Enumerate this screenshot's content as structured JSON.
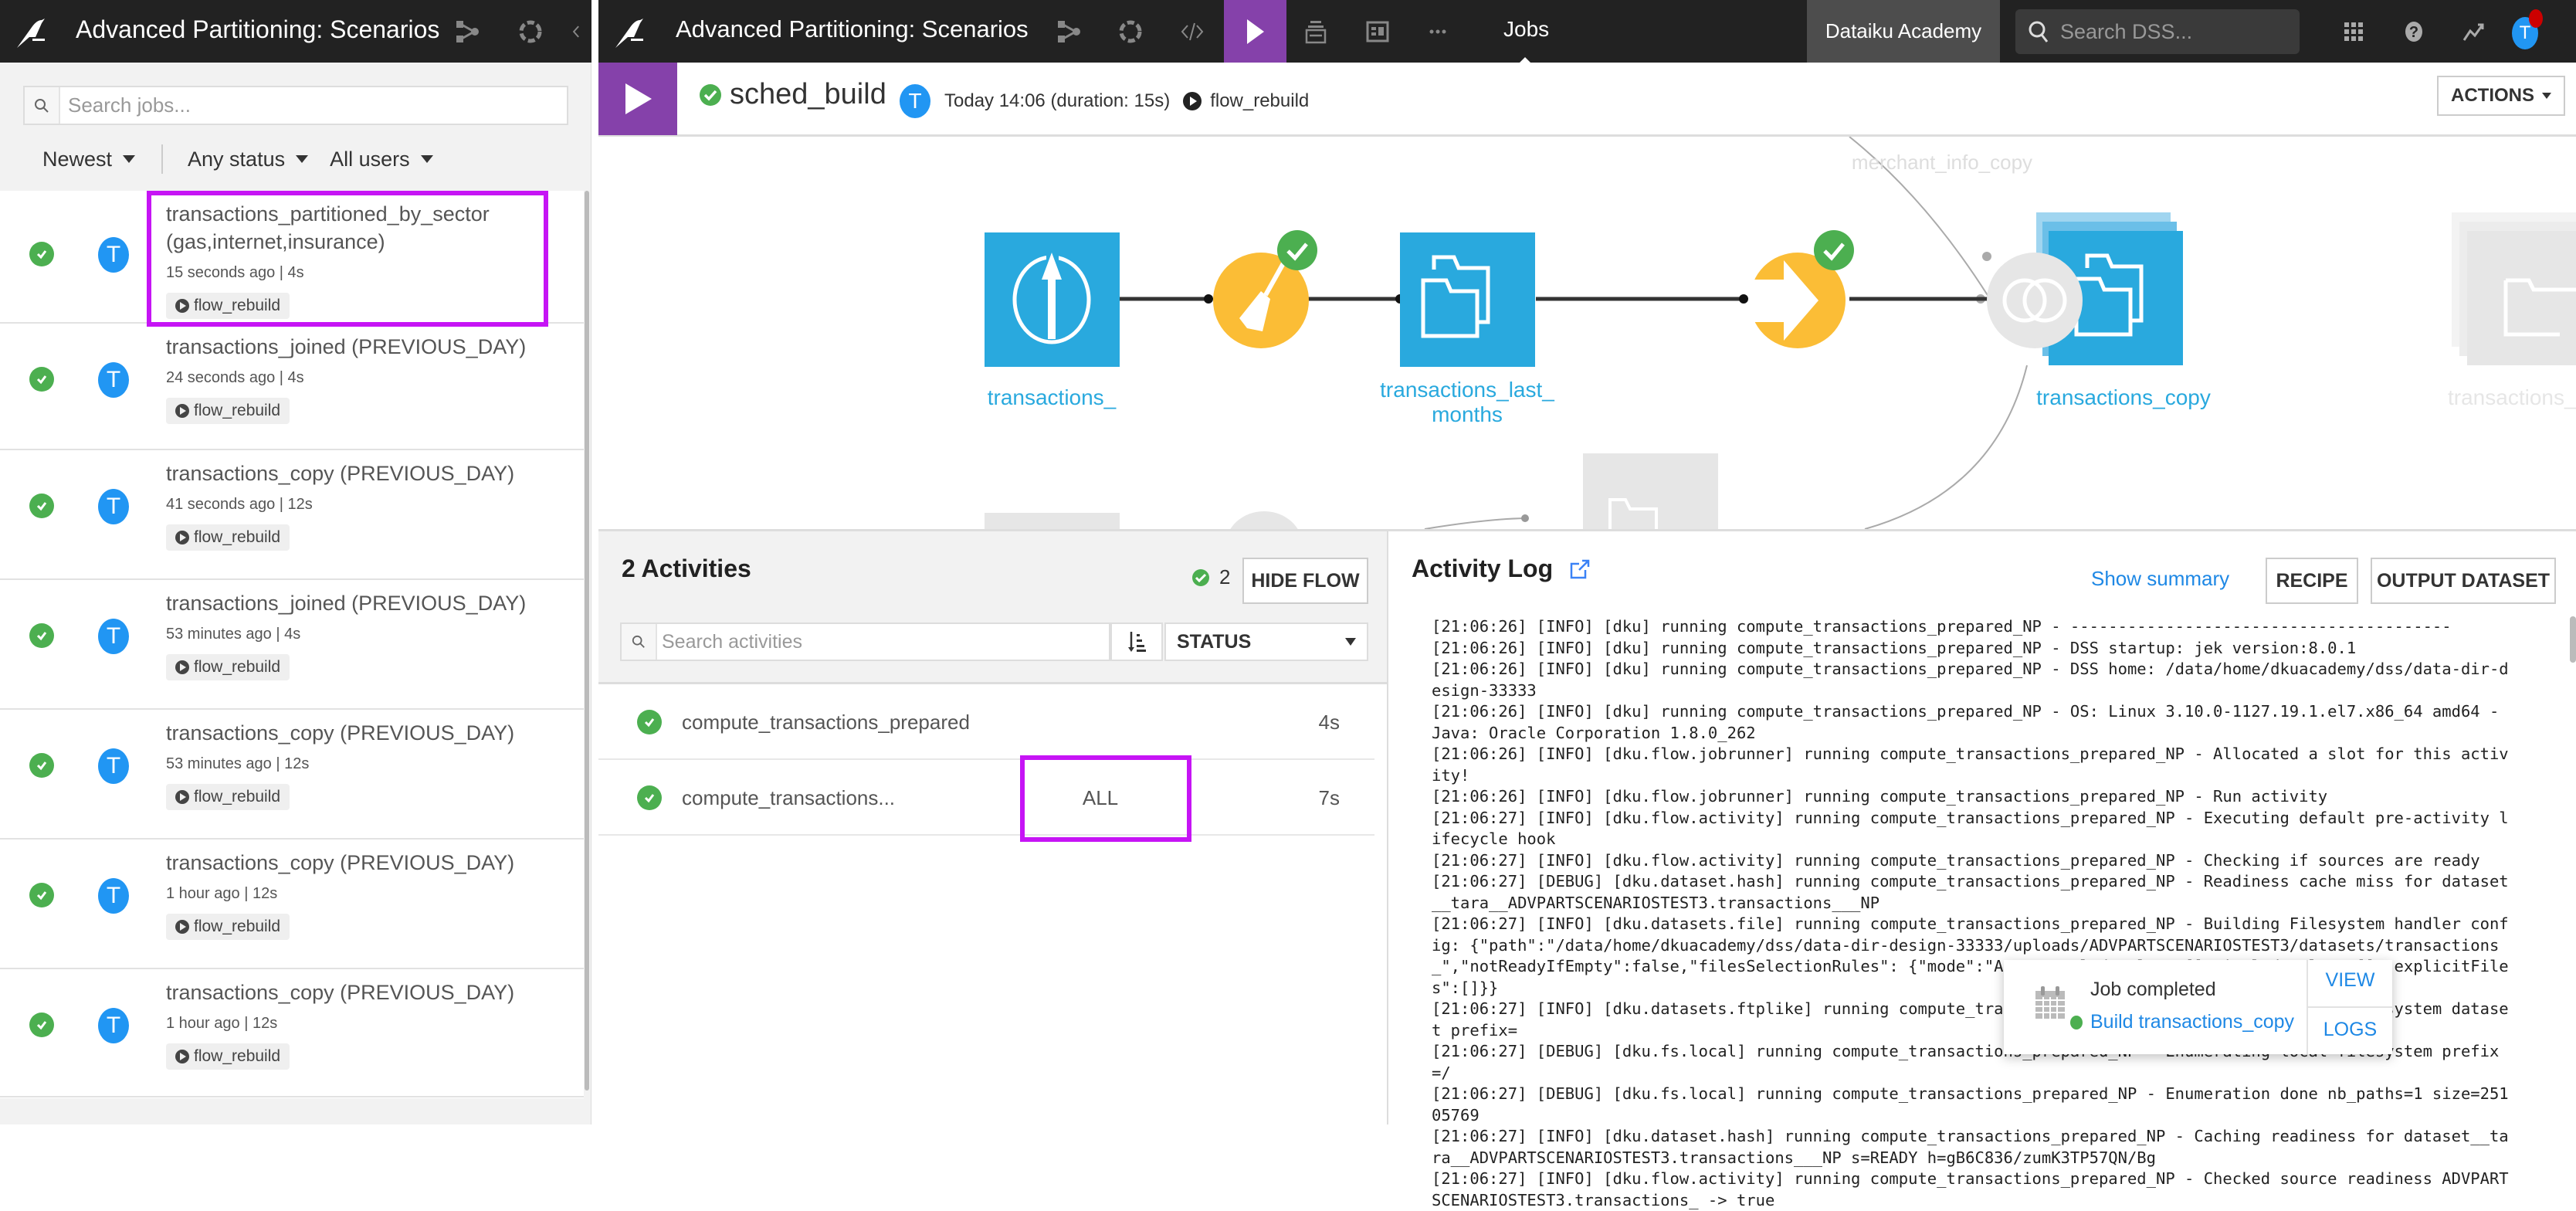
{
  "left_panel": {
    "project_title": "Advanced Partitioning: Scenarios",
    "search": {
      "placeholder": "Search jobs...",
      "value": ""
    },
    "filters": {
      "sort": "Newest",
      "status": "Any status",
      "users": "All users"
    },
    "jobs": [
      {
        "title": "transactions_partitioned_by_sector (gas,internet,insurance)",
        "time": "15 seconds ago",
        "duration": "4s",
        "scenario": "flow_rebuild",
        "user_initial": "T",
        "status": "success",
        "highlighted": true
      },
      {
        "title": "transactions_joined (PREVIOUS_DAY)",
        "time": "24 seconds ago",
        "duration": "4s",
        "scenario": "flow_rebuild",
        "user_initial": "T",
        "status": "success"
      },
      {
        "title": "transactions_copy (PREVIOUS_DAY)",
        "time": "41 seconds ago",
        "duration": "12s",
        "scenario": "flow_rebuild",
        "user_initial": "T",
        "status": "success"
      },
      {
        "title": "transactions_joined (PREVIOUS_DAY)",
        "time": "53 minutes ago",
        "duration": "4s",
        "scenario": "flow_rebuild",
        "user_initial": "T",
        "status": "success"
      },
      {
        "title": "transactions_copy (PREVIOUS_DAY)",
        "time": "53 minutes ago",
        "duration": "12s",
        "scenario": "flow_rebuild",
        "user_initial": "T",
        "status": "success"
      },
      {
        "title": "transactions_copy (PREVIOUS_DAY)",
        "time": "1 hour ago",
        "duration": "12s",
        "scenario": "flow_rebuild",
        "user_initial": "T",
        "status": "success"
      },
      {
        "title": "transactions_copy (PREVIOUS_DAY)",
        "time": "1 hour ago",
        "duration": "12s",
        "scenario": "flow_rebuild",
        "user_initial": "T",
        "status": "success"
      }
    ]
  },
  "navbar": {
    "project_title": "Advanced Partitioning: Scenarios",
    "active_section": "Jobs",
    "instance_name": "Dataiku Academy",
    "search_placeholder": "Search DSS...",
    "user_initial": "T",
    "icons": [
      "flow-icon",
      "lab-icon",
      "code-icon",
      "jobs-play-icon",
      "library-icon",
      "dashboard-icon",
      "more-icon",
      "apps-grid-icon",
      "help-icon",
      "activity-icon"
    ]
  },
  "job_header": {
    "job_name": "sched_build",
    "status": "success",
    "user_initial": "T",
    "time": "Today 14:06 (duration: 15s)",
    "scenario": "flow_rebuild",
    "actions_label": "ACTIONS"
  },
  "flow": {
    "nodes": [
      {
        "label": "transactions_",
        "type": "uploaded-dataset",
        "active": true
      },
      {
        "label": "",
        "type": "prepare-recipe",
        "active": true,
        "done": true
      },
      {
        "label": "transactions_last_ months",
        "type": "dataset",
        "active": true
      },
      {
        "label": "",
        "type": "sync-recipe",
        "active": true,
        "done": true
      },
      {
        "label": "transactions_copy",
        "type": "partitioned-dataset",
        "active": true
      },
      {
        "label": "",
        "type": "join-recipe",
        "active": false
      },
      {
        "label": "transactions_",
        "type": "partitioned-dataset",
        "active": false
      },
      {
        "label": "merchant_info_copy",
        "type": "dataset",
        "active": false
      }
    ]
  },
  "activities": {
    "title": "2 Activities",
    "success_count": "2",
    "hide_flow_label": "HIDE FLOW",
    "search_placeholder": "Search activities",
    "status_filter": "STATUS",
    "items": [
      {
        "name": "compute_transactions_prepared",
        "partition": "",
        "duration": "4s",
        "status": "success"
      },
      {
        "name": "compute_transactions...",
        "partition": "ALL",
        "duration": "7s",
        "status": "success"
      }
    ]
  },
  "activity_log": {
    "title": "Activity Log",
    "show_summary_label": "Show summary",
    "recipe_label": "RECIPE",
    "output_dataset_label": "OUTPUT DATASET",
    "lines": [
      "[21:06:26] [INFO] [dku] running compute_transactions_prepared_NP - ----------------------------------------",
      "[21:06:26] [INFO] [dku] running compute_transactions_prepared_NP - DSS startup: jek version:8.0.1",
      "[21:06:26] [INFO] [dku] running compute_transactions_prepared_NP - DSS home: /data/home/dkuacademy/dss/data-dir-design-33333",
      "[21:06:26] [INFO] [dku] running compute_transactions_prepared_NP - OS: Linux 3.10.0-1127.19.1.el7.x86_64 amd64 - Java: Oracle Corporation 1.8.0_262",
      "[21:06:26] [INFO] [dku.flow.jobrunner] running compute_transactions_prepared_NP - Allocated a slot for this activity!",
      "[21:06:26] [INFO] [dku.flow.jobrunner] running compute_transactions_prepared_NP - Run activity",
      "[21:06:27] [INFO] [dku.flow.activity] running compute_transactions_prepared_NP - Executing default pre-activity lifecycle hook",
      "[21:06:27] [INFO] [dku.flow.activity] running compute_transactions_prepared_NP - Checking if sources are ready",
      "[21:06:27] [DEBUG] [dku.dataset.hash] running compute_transactions_prepared_NP - Readiness cache miss for dataset__tara__ADVPARTSCENARIOSTEST3.transactions___NP",
      "[21:06:27] [INFO] [dku.datasets.file] running compute_transactions_prepared_NP - Building Filesystem handler config: {\"path\":\"/data/home/dkuacademy/dss/data-dir-design-33333/uploads/ADVPARTSCENARIOSTEST3/datasets/transactions_\",\"notReadyIfEmpty\":false,\"filesSelectionRules\": {\"mode\":\"ALL\",\"excludeRules\":[],\"includeRules\":[],\"explicitFiles\":[]}}",
      "[21:06:27] [INFO] [dku.datasets.ftplike] running compute_transactions_prepared_NP - Enumerating Filesystem dataset prefix=",
      "[21:06:27] [DEBUG] [dku.fs.local] running compute_transactions_prepared_NP - Enumerating local filesystem prefix=/",
      "[21:06:27] [DEBUG] [dku.fs.local] running compute_transactions_prepared_NP - Enumeration done nb_paths=1 size=25105769",
      "[21:06:27] [INFO] [dku.dataset.hash] running compute_transactions_prepared_NP - Caching readiness for dataset__tara__ADVPARTSCENARIOSTEST3.transactions___NP s=READY h=gB6C836/zumK3TP57QN/Bg",
      "[21:06:27] [INFO] [dku.flow.activity] running compute_transactions_prepared_NP - Checked source readiness ADVPARTSCENARIOSTEST3.transactions_ -> true"
    ]
  },
  "toast": {
    "title": "Job completed",
    "link": "Build transactions_copy",
    "view_label": "VIEW",
    "logs_label": "LOGS"
  },
  "colors": {
    "accent_purple": "#8541aa",
    "highlight_magenta": "#c614f5",
    "dataset_blue": "#29a9de",
    "recipe_yellow": "#fbbd36",
    "success_green": "#4caf50",
    "link_blue": "#1e88e5",
    "navbar_bg": "#222222"
  }
}
